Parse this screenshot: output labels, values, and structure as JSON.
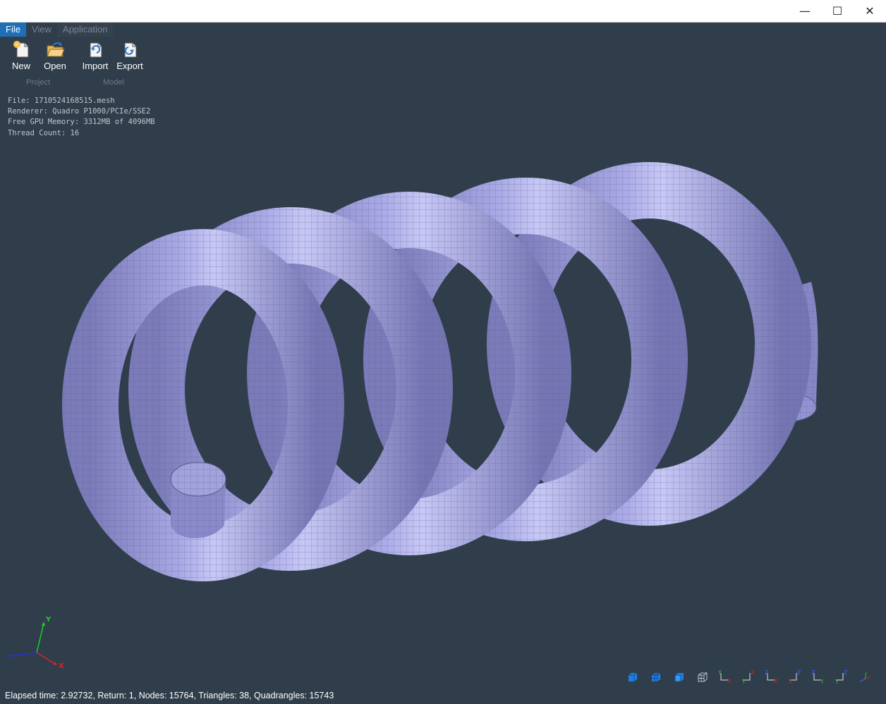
{
  "window": {
    "controls": {
      "minimize": "—",
      "maximize": "☐",
      "close": "✕"
    }
  },
  "menubar": {
    "file": "File",
    "view": "View",
    "application": "Application"
  },
  "toolbar": {
    "new_label": "New",
    "open_label": "Open",
    "import_label": "Import",
    "export_label": "Export",
    "project_group": "Project",
    "model_group": "Model"
  },
  "info": {
    "file": "File: 1710524168515.mesh",
    "renderer": "Renderer: Quadro P1000/PCIe/SSE2",
    "gpu_memory": "Free GPU Memory: 3312MB of 4096MB",
    "thread_count": "Thread Count: 16"
  },
  "axes": {
    "x": "X",
    "y": "Y"
  },
  "view_buttons": [
    {
      "icon": "solid-cube-icon"
    },
    {
      "icon": "shaded-mesh-cube-icon"
    },
    {
      "icon": "front-cube-icon"
    },
    {
      "icon": "wireframe-cube-icon"
    },
    {
      "icon": "view-xy-icon",
      "labels": [
        "Y",
        "X"
      ]
    },
    {
      "icon": "view-yx-icon",
      "labels": [
        "Y",
        "X"
      ]
    },
    {
      "icon": "view-zx-icon",
      "labels": [
        "Z",
        "X"
      ]
    },
    {
      "icon": "view-xz-icon",
      "labels": [
        "Z",
        "X"
      ]
    },
    {
      "icon": "view-zy-icon",
      "labels": [
        "Z",
        "Y"
      ]
    },
    {
      "icon": "view-yz-icon",
      "labels": [
        "Z",
        "Y"
      ]
    },
    {
      "icon": "isometric-view-icon"
    }
  ],
  "colors": {
    "background": "#2f3e4a",
    "mesh_fill": "#8787c7",
    "mesh_edges": "#5a5a8c",
    "menu_active": "#1e6fb8"
  },
  "status": {
    "text": "Elapsed time: 2.92732, Return: 1, Nodes: 15764, Triangles: 38, Quadrangles: 15743"
  }
}
